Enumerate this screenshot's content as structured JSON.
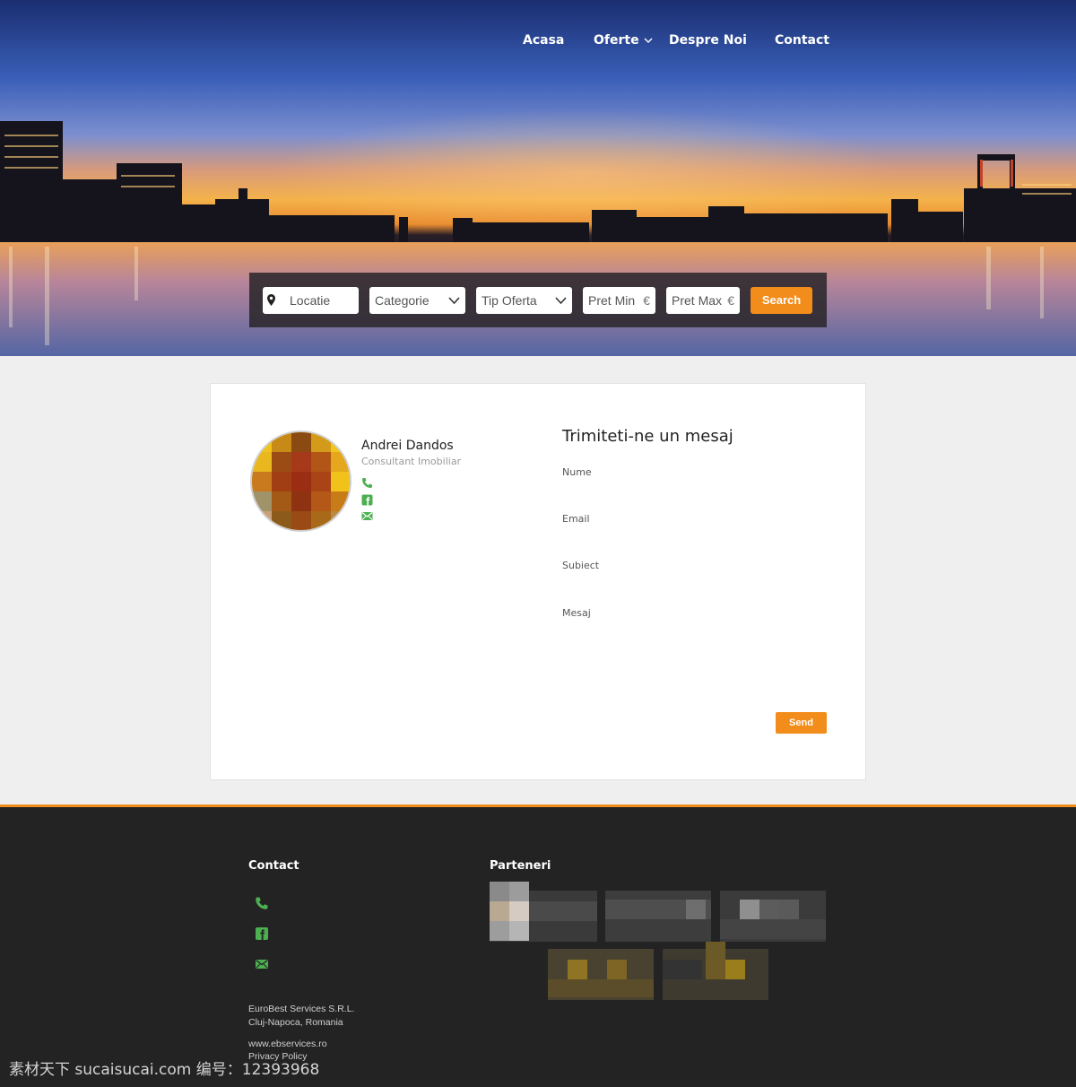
{
  "nav": {
    "items": [
      {
        "label": "Acasa"
      },
      {
        "label": "Oferte",
        "has_dropdown": true
      },
      {
        "label": "Despre Noi"
      },
      {
        "label": "Contact"
      }
    ]
  },
  "search": {
    "location_placeholder": "Locatie",
    "category_value": "Categorie",
    "offer_type_value": "Tip Oferta",
    "price_min_placeholder": "Pret Min",
    "price_max_placeholder": "Pret Max",
    "currency": "€",
    "button_label": "Search"
  },
  "agent": {
    "name": "Andrei Dandos",
    "role": "Consultant Imobiliar",
    "icons": [
      "phone-icon",
      "facebook-icon",
      "mail-icon"
    ]
  },
  "contact_form": {
    "title": "Trimiteti-ne un mesaj",
    "fields": [
      "Nume",
      "Email",
      "Subiect",
      "Mesaj"
    ],
    "send_label": "Send"
  },
  "footer": {
    "contact_heading": "Contact",
    "partners_heading": "Parteneri",
    "company": "EuroBest Services S.R.L.",
    "city": "Cluj-Napoca, Romania",
    "website": "www.ebservices.ro",
    "privacy": "Privacy Policy"
  },
  "watermark": "素材天下 sucaisucai.com  编号：12393968",
  "colors": {
    "accent": "#f28c1b",
    "icon_green": "#4caf50",
    "footer_bg": "#232323"
  }
}
